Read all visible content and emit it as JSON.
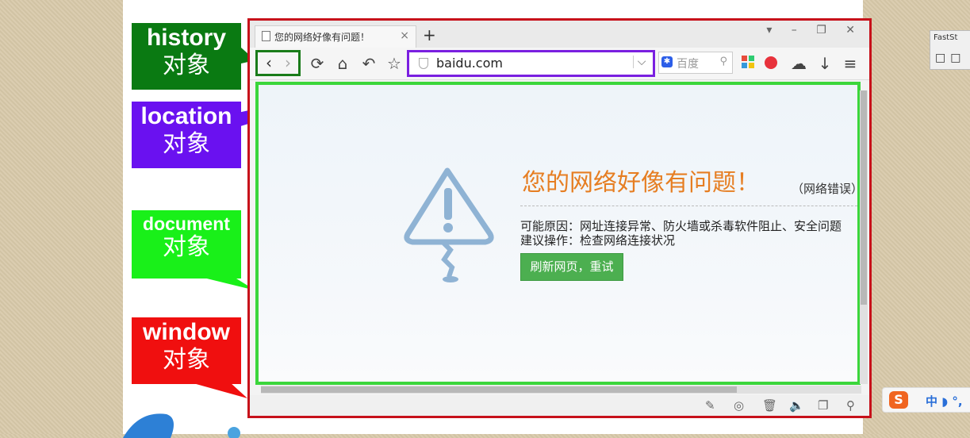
{
  "labels": {
    "history": {
      "en": "history",
      "cn": "对象",
      "color": "#0a7a12"
    },
    "location": {
      "en": "location",
      "cn": "对象",
      "color": "#6a11f0"
    },
    "document": {
      "en": "document",
      "cn": "对象",
      "color": "#19f019"
    },
    "window": {
      "en": "window",
      "cn": "对象",
      "color": "#f00f0f"
    }
  },
  "browser": {
    "tab_title": "您的网络好像有问题！",
    "tab_close": "×",
    "new_tab": "+",
    "window_controls": "▾ – ❐ ✕",
    "url": "baidu.com",
    "search_placeholder": "百度",
    "error": {
      "title": "您的网络好像有问题！",
      "code": "（网络错误）",
      "reason": "可能原因：网址连接异常、防火墙或杀毒软件阻止、安全问题",
      "suggestion": "建议操作：检查网络连接状况",
      "retry_label": "刷新网页，重试"
    }
  },
  "taskbar": {
    "app_name": "FastSt",
    "ime_text": "中 ◗ °,"
  },
  "colors": {
    "window_border": "#c7111a",
    "history_border": "#1a7c1a",
    "location_border": "#7a1fe0",
    "document_border": "#3bd63b",
    "error_title": "#e67e22",
    "retry_button": "#4caf50"
  }
}
